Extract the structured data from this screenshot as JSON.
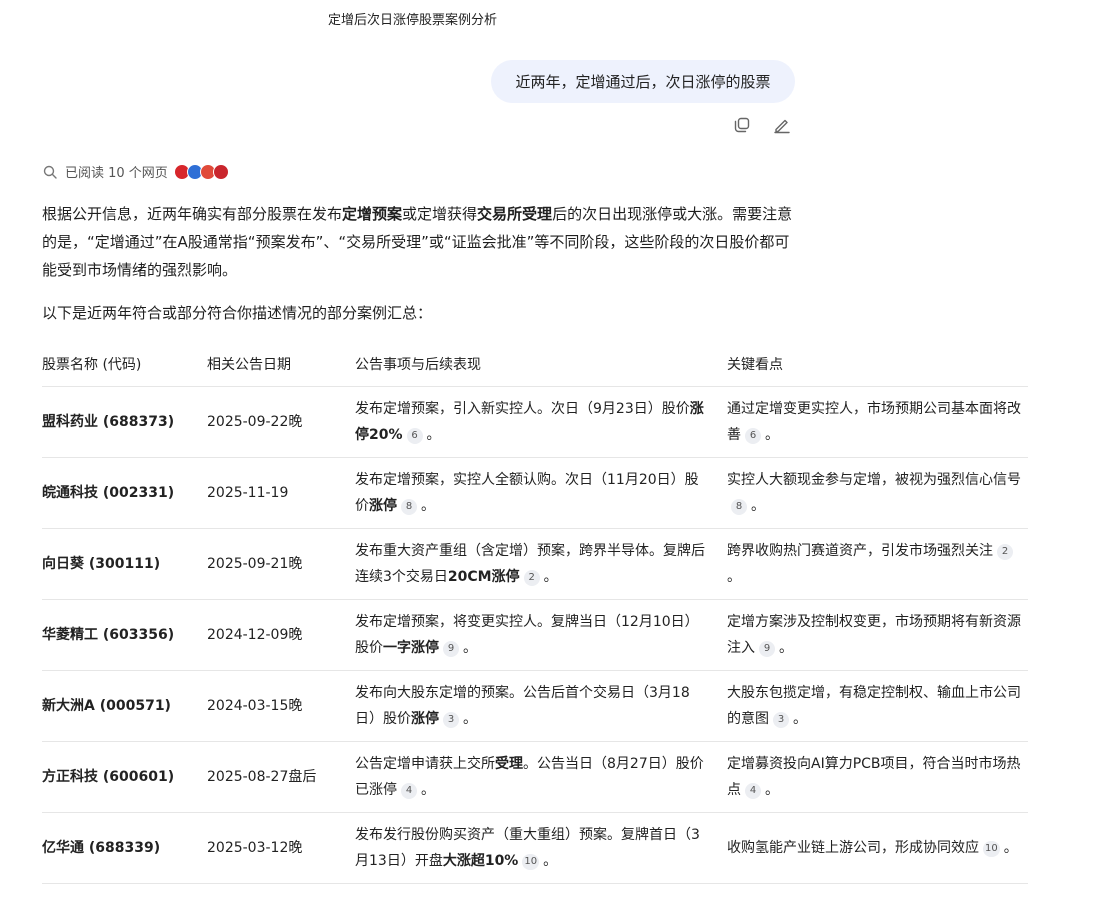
{
  "chat": {
    "title": "定增后次日涨停股票案例分析",
    "user_message": "近两年，定增通过后，次日涨停的股票",
    "actions": {
      "copy_icon": "copy-icon",
      "edit_icon": "edit-icon"
    }
  },
  "sources": {
    "icon": "search-icon",
    "text": "已阅读 10 个网页"
  },
  "answer": {
    "p1_a": "根据公开信息，近两年确实有部分股票在发布",
    "p1_b": "定增预案",
    "p1_c": "或定增获得",
    "p1_d": "交易所受理",
    "p1_e": "后的次日出现涨停或大涨。需要注意的是，“定增通过”在A股通常指“预案发布”、“交易所受理”或“证监会批准”等不同阶段，这些阶段的次日股价都可能受到市场情绪的强烈影响。",
    "p2": "以下是近两年符合或部分符合你描述情况的部分案例汇总："
  },
  "table": {
    "headers": [
      "股票名称 (代码)",
      "相关公告日期",
      "公告事项与后续表现",
      "关键看点"
    ],
    "rows": [
      {
        "name": "盟科药业 (688373)",
        "date": "2025-09-22晚",
        "event_a": "发布定增预案，引入新实控人。次日（9月23日）股价",
        "event_b": "涨停20%",
        "event_c": "",
        "event_cite": "6",
        "point": "通过定增变更实控人，市场预期公司基本面将改善",
        "point_cite": "6"
      },
      {
        "name": "皖通科技 (002331)",
        "date": "2025-11-19",
        "event_a": "发布定增预案，实控人全额认购。次日（11月20日）股价",
        "event_b": "涨停",
        "event_c": "",
        "event_cite": "8",
        "point": "实控人大额现金参与定增，被视为强烈信心信号",
        "point_cite": "8"
      },
      {
        "name": "向日葵 (300111)",
        "date": "2025-09-21晚",
        "event_a": "发布重大资产重组（含定增）预案，跨界半导体。复牌后连续3个交易日",
        "event_b": "20CM涨停",
        "event_c": "",
        "event_cite": "2",
        "point": "跨界收购热门赛道资产，引发市场强烈关注",
        "point_cite": "2"
      },
      {
        "name": "华菱精工 (603356)",
        "date": "2024-12-09晚",
        "event_a": "发布定增预案，将变更实控人。复牌当日（12月10日）股价",
        "event_b": "一字涨停",
        "event_c": "",
        "event_cite": "9",
        "point": "定增方案涉及控制权变更，市场预期将有新资源注入",
        "point_cite": "9"
      },
      {
        "name": "新大洲A (000571)",
        "date": "2024-03-15晚",
        "event_a": "发布向大股东定增的预案。公告后首个交易日（3月18日）股价",
        "event_b": "涨停",
        "event_c": "",
        "event_cite": "3",
        "point": "大股东包揽定增，有稳定控制权、输血上市公司的意图",
        "point_cite": "3"
      },
      {
        "name": "方正科技 (600601)",
        "date": "2025-08-27盘后",
        "event_a": "公告定增申请获上交所",
        "event_b": "受理",
        "event_c": "。公告当日（8月27日）股价已涨停",
        "event_cite": "4",
        "point": "定增募资投向AI算力PCB项目，符合当时市场热点",
        "point_cite": "4"
      },
      {
        "name": "亿华通 (688339)",
        "date": "2025-03-12晚",
        "event_a": "发布发行股份购买资产（重大重组）预案。复牌首日（3月13日）开盘",
        "event_b": "大涨超10%",
        "event_c": "",
        "event_cite": "10",
        "point": "收购氢能产业链上游公司，形成协同效应",
        "point_cite": "10"
      }
    ]
  }
}
